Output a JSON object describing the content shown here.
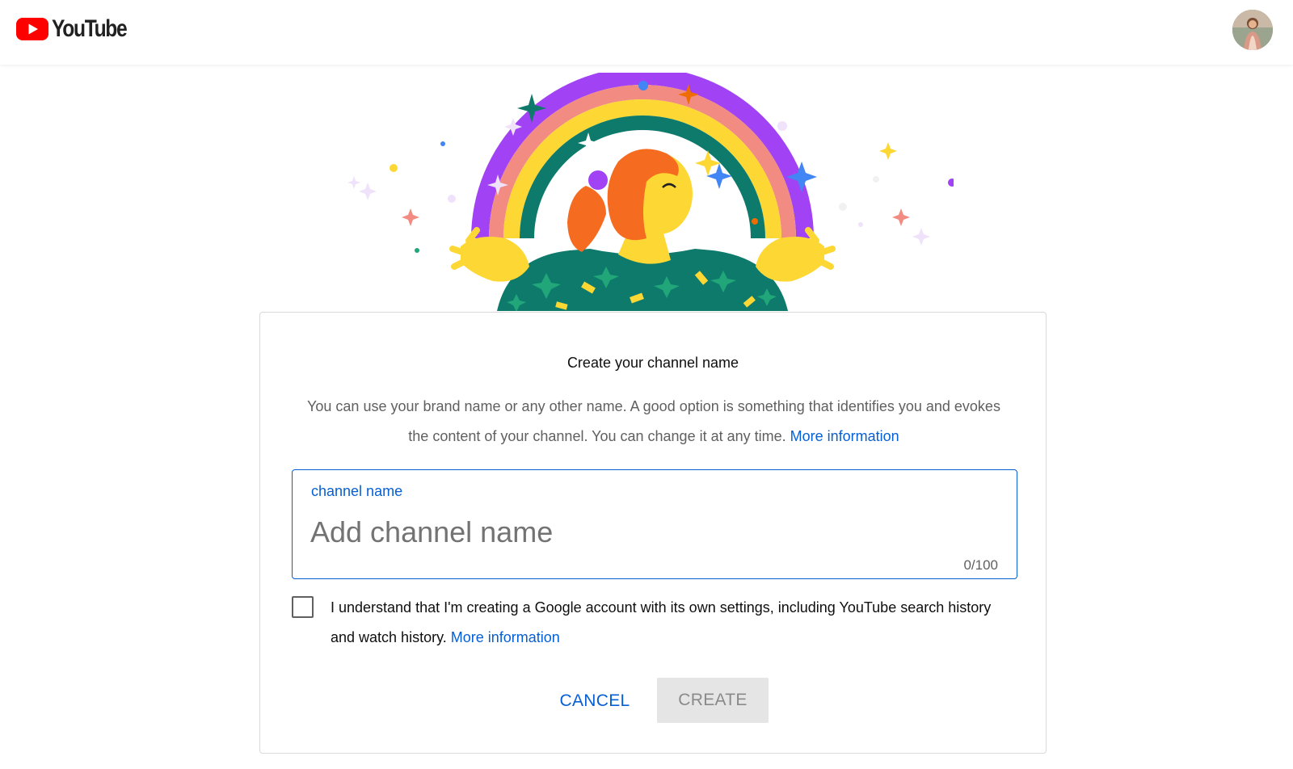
{
  "header": {
    "logo_text": "YouTube",
    "logo_icon": "youtube-play-icon",
    "avatar": "user-avatar"
  },
  "colors": {
    "brand_red": "#ff0000",
    "link_blue": "#065fd4",
    "button_disabled_bg": "#e5e5e5",
    "button_disabled_text": "#8a8a8a"
  },
  "dialog": {
    "title": "Create your channel name",
    "description": "You can use your brand name or any other name. A good option is something that identifies you and evokes the content of your channel. You can change it at any time.",
    "description_link": "More information",
    "field": {
      "label": "channel name",
      "value": "",
      "placeholder": "Add channel name",
      "counter": "0/100"
    },
    "checkbox": {
      "checked": false,
      "text": "I understand that I'm creating a Google account with its own settings, including YouTube search history and watch history.",
      "link": "More information"
    },
    "cancel_label": "CANCEL",
    "create_label": "CREATE"
  }
}
